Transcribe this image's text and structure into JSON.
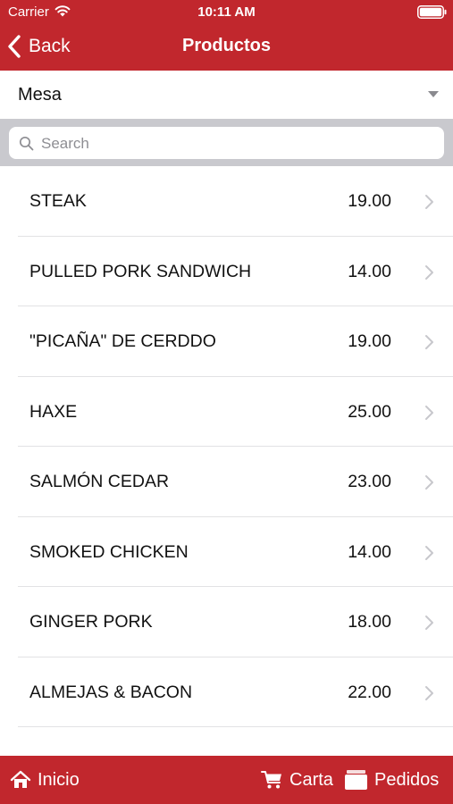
{
  "status_bar": {
    "carrier": "Carrier",
    "time": "10:11 AM"
  },
  "nav": {
    "back_label": "Back",
    "title": "Productos"
  },
  "selector": {
    "value": "Mesa"
  },
  "search": {
    "placeholder": "Search"
  },
  "products": [
    {
      "name": "STEAK",
      "price": "19.00"
    },
    {
      "name": "PULLED PORK SANDWICH",
      "price": "14.00"
    },
    {
      "name": "\"PICAÑA\" DE CERDDO",
      "price": "19.00"
    },
    {
      "name": "HAXE",
      "price": "25.00"
    },
    {
      "name": "SALMÓN CEDAR",
      "price": "23.00"
    },
    {
      "name": "SMOKED CHICKEN",
      "price": "14.00"
    },
    {
      "name": "GINGER PORK",
      "price": "18.00"
    },
    {
      "name": "ALMEJAS & BACON",
      "price": "22.00"
    }
  ],
  "tabbar": {
    "inicio": "Inicio",
    "carta": "Carta",
    "pedidos": "Pedidos"
  },
  "icons": {
    "status": [
      "wifi-icon",
      "battery-icon"
    ],
    "nav": "chevron-left-icon",
    "selector": "dropdown-triangle-icon",
    "search": "search-icon",
    "row": "chevron-right-icon",
    "tabs": [
      "home-icon",
      "cart-icon",
      "orders-icon"
    ]
  },
  "colors": {
    "brand_red": "#c1272d",
    "search_bar_bg": "#c9c9ce",
    "separator": "#e2e2e4",
    "chevron": "#c7c7cc"
  }
}
